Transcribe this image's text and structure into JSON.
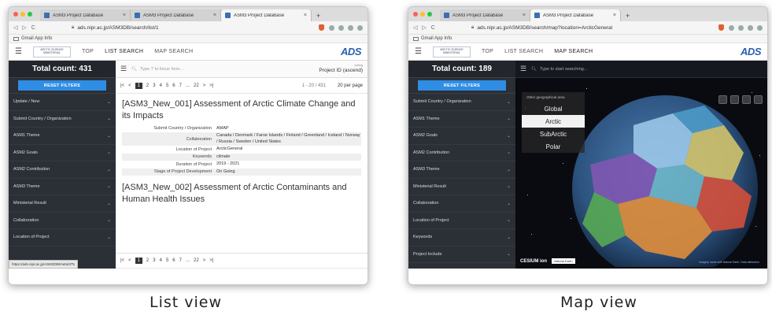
{
  "captions": {
    "list": "List view",
    "map": "Map view"
  },
  "list_window": {
    "tabs": [
      "ASM3 Project Database",
      "ASM3 Project Database",
      "ASM3 Project Database"
    ],
    "url": "ads.nipr.ac.jp/ASM3DB/search/list/1",
    "bookmark": "Gmail App Info",
    "nav": [
      "TOP",
      "LIST SEARCH",
      "MAP SEARCH"
    ],
    "brand": "ADS",
    "logo_text": "ARCTIC SCIENCE MINISTERIAL",
    "total_count": "Total count: 431",
    "reset_label": "RESET FILTERS",
    "filters": [
      "Update / New",
      "Submit Country / Organization",
      "ASM1 Theme",
      "ASM2 Goals",
      "ASM2 Contribution",
      "ASM3 Theme",
      "Ministerial Result",
      "Collaboration",
      "Location of Project"
    ],
    "search_placeholder": "Type '/' to focus here...",
    "sorting_label": "sorting",
    "sorting_value": "Project ID (ascend)",
    "pager": [
      "1",
      "2",
      "3",
      "4",
      "5",
      "6",
      "7",
      "...",
      "22"
    ],
    "range": "1 - 20 / 431",
    "per_page": "20 per page",
    "records": [
      {
        "title": "[ASM3_New_001] Assessment of Arctic Climate Change and its Impacts",
        "fields": [
          {
            "k": "Submit Country / Organization",
            "v": "AMAP"
          },
          {
            "k": "Collaboration",
            "v": "Canada / Denmark / Faroe Islands / Finland / Greenland / Iceland / Norway / Russia / Sweden / United States"
          },
          {
            "k": "Location of Project",
            "v": "ArcticGeneral"
          },
          {
            "k": "Keywords",
            "v": "climate"
          },
          {
            "k": "Duration of Project",
            "v": "2019 - 2021"
          },
          {
            "k": "Stage of Project Development",
            "v": "On Going"
          }
        ]
      },
      {
        "title": "[ASM3_New_002] Assessment of Arctic Contaminants and Human Health Issues",
        "fields": []
      }
    ],
    "status_url": "https://ads.nipr.ac.jp/ASM3DB/meta/375"
  },
  "map_window": {
    "tabs": [
      "ASM3 Project Database",
      "ASM3 Project Database"
    ],
    "url": "ads.nipr.ac.jp/ASM3DB/search/map?location=ArcticGeneral",
    "bookmark": "Gmail App Info",
    "nav": [
      "TOP",
      "LIST SEARCH",
      "MAP SEARCH"
    ],
    "brand": "ADS",
    "logo_text": "ARCTIC SCIENCE MINISTERIAL",
    "total_count": "Total count: 189",
    "reset_label": "RESET FILTERS",
    "filters": [
      "Submit Country / Organization",
      "ASM1 Theme",
      "ASM2 Goals",
      "ASM2 Contribution",
      "ASM3 Theme",
      "Ministerial Result",
      "Collaboration",
      "Location of Project",
      "Keywords",
      "Project Include"
    ],
    "search_placeholder": "Type to start searching...",
    "area_header": "Other geographical area",
    "areas": [
      "Global",
      "Arctic",
      "SubArctic",
      "Polar"
    ],
    "selected_area": "Arctic",
    "cesium": "CESIUM ion",
    "natural_earth": "Natural Earth",
    "attribution": "Imagery made with Natural Earth. Data attribution"
  }
}
